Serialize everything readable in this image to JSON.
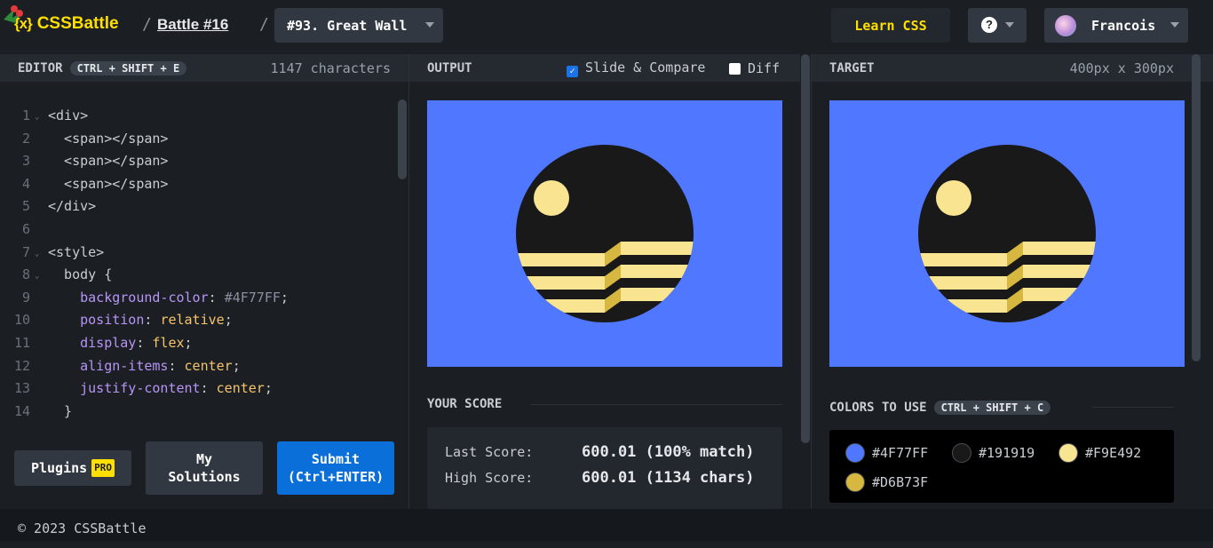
{
  "header": {
    "logo_text": "CSSBattle",
    "logo_mark": "{x}",
    "battle_link": "Battle #16",
    "separator": "/",
    "target_select": "#93. Great Wall",
    "learn_button": "Learn CSS",
    "help_icon": "?",
    "user_name": "Francois"
  },
  "editor": {
    "title": "EDITOR",
    "shortcut": "CTRL + SHIFT + E",
    "char_count": "1147 characters",
    "lines": [
      {
        "n": "1",
        "fold": true,
        "segs": [
          [
            "tg",
            "<div>"
          ]
        ]
      },
      {
        "n": "2",
        "fold": false,
        "segs": [
          [
            "tg",
            "  <span></span>"
          ]
        ]
      },
      {
        "n": "3",
        "fold": false,
        "segs": [
          [
            "tg",
            "  <span></span>"
          ]
        ]
      },
      {
        "n": "4",
        "fold": false,
        "segs": [
          [
            "tg",
            "  <span></span>"
          ]
        ]
      },
      {
        "n": "5",
        "fold": false,
        "segs": [
          [
            "tg",
            "</div>"
          ]
        ]
      },
      {
        "n": "6",
        "fold": false,
        "segs": []
      },
      {
        "n": "7",
        "fold": true,
        "segs": [
          [
            "tg",
            "<style>"
          ]
        ]
      },
      {
        "n": "8",
        "fold": true,
        "segs": [
          [
            "tg",
            "  body {"
          ]
        ]
      },
      {
        "n": "9",
        "fold": false,
        "segs": [
          [
            "pr",
            "    background-color"
          ],
          [
            "tg",
            ": "
          ],
          [
            "hx",
            "#4F77FF"
          ],
          [
            "tg",
            ";"
          ]
        ]
      },
      {
        "n": "10",
        "fold": false,
        "segs": [
          [
            "pr",
            "    position"
          ],
          [
            "tg",
            ": "
          ],
          [
            "vl",
            "relative"
          ],
          [
            "tg",
            ";"
          ]
        ]
      },
      {
        "n": "11",
        "fold": false,
        "segs": [
          [
            "pr",
            "    display"
          ],
          [
            "tg",
            ": "
          ],
          [
            "vl",
            "flex"
          ],
          [
            "tg",
            ";"
          ]
        ]
      },
      {
        "n": "12",
        "fold": false,
        "segs": [
          [
            "pr",
            "    align-items"
          ],
          [
            "tg",
            ": "
          ],
          [
            "vl",
            "center"
          ],
          [
            "tg",
            ";"
          ]
        ]
      },
      {
        "n": "13",
        "fold": false,
        "segs": [
          [
            "pr",
            "    justify-content"
          ],
          [
            "tg",
            ": "
          ],
          [
            "vl",
            "center"
          ],
          [
            "tg",
            ";"
          ]
        ]
      },
      {
        "n": "14",
        "fold": false,
        "segs": [
          [
            "tg",
            "  }"
          ]
        ]
      }
    ],
    "plugins_button": "Plugins",
    "pro_badge": "PRO",
    "my_solutions_button": "My Solutions",
    "submit_button": "Submit (Ctrl+ENTER)"
  },
  "output": {
    "title": "OUTPUT",
    "slide_compare": "Slide & Compare",
    "slide_compare_checked": true,
    "diff": "Diff",
    "diff_checked": false
  },
  "score": {
    "title": "YOUR SCORE",
    "last_label": "Last Score:",
    "last_value": "600.01 (100% match)",
    "high_label": "High Score:",
    "high_value": "600.01 (1134 chars)"
  },
  "target": {
    "title": "TARGET",
    "size": "400px x 300px"
  },
  "colors": {
    "title": "COLORS TO USE",
    "shortcut": "CTRL + SHIFT + C",
    "items": [
      "#4F77FF",
      "#191919",
      "#F9E492",
      "#D6B73F"
    ]
  },
  "footer": {
    "copyright": "© 2023 CSSBattle"
  }
}
